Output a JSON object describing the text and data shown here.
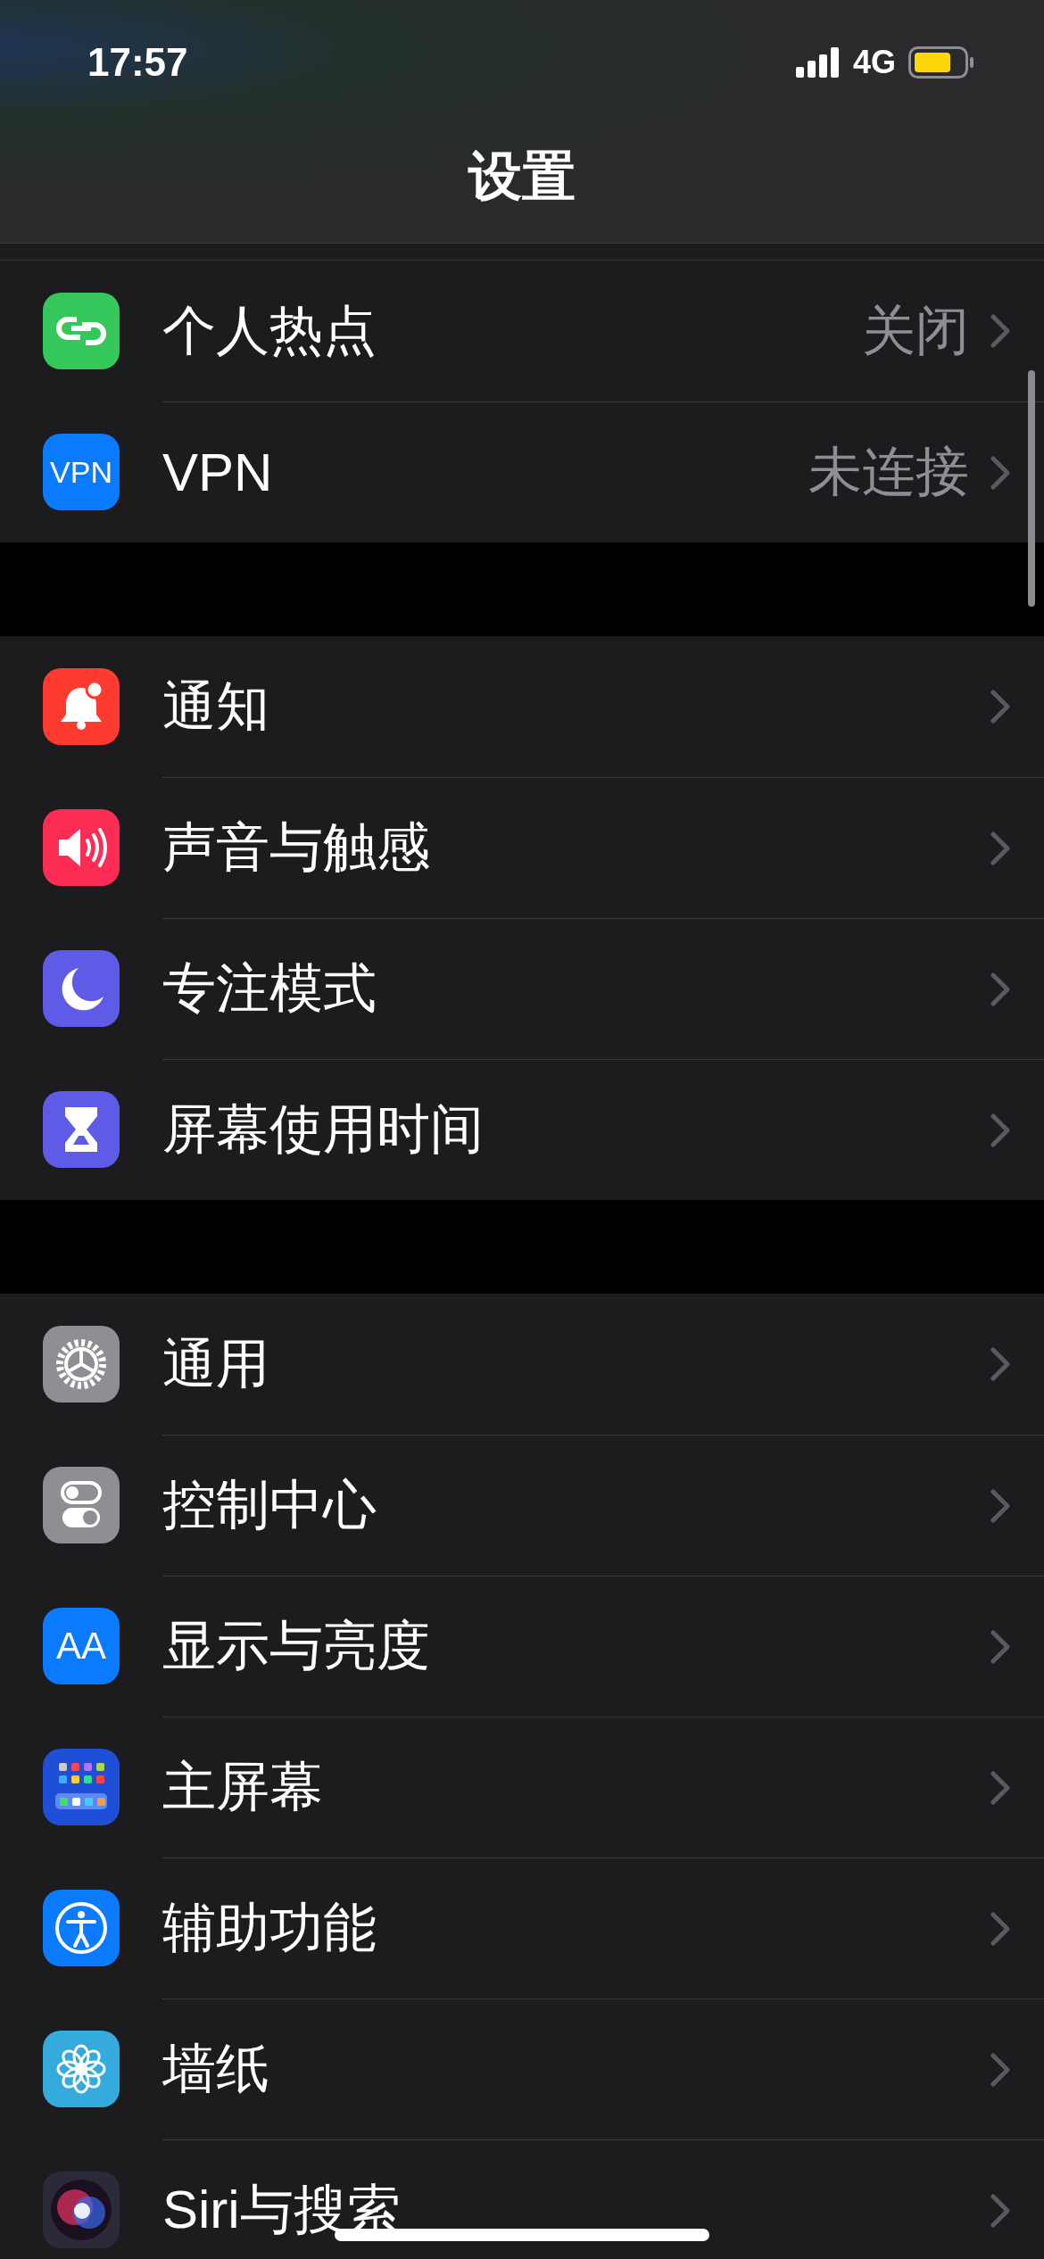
{
  "status_bar": {
    "time": "17:57",
    "network": "4G"
  },
  "title": "设置",
  "groups": [
    {
      "rows": [
        {
          "kind": "hotspot",
          "color": "#34c759",
          "label": "个人热点",
          "value": "关闭"
        },
        {
          "kind": "vpn",
          "color": "#0a7aff",
          "icon_text": "VPN",
          "label": "VPN",
          "value": "未连接"
        }
      ]
    },
    {
      "rows": [
        {
          "kind": "bell",
          "color": "#ff3b30",
          "label": "通知"
        },
        {
          "kind": "speaker",
          "color": "#ff2d55",
          "label": "声音与触感"
        },
        {
          "kind": "moon",
          "color": "#5e5ce6",
          "label": "专注模式"
        },
        {
          "kind": "hourglass",
          "color": "#5e5ce6",
          "label": "屏幕使用时间"
        }
      ]
    },
    {
      "rows": [
        {
          "kind": "gear",
          "color": "#8e8e93",
          "label": "通用"
        },
        {
          "kind": "toggles",
          "color": "#8e8e93",
          "label": "控制中心"
        },
        {
          "kind": "text",
          "color": "#0a7aff",
          "icon_text": "AA",
          "label": "显示与亮度"
        },
        {
          "kind": "grid",
          "color": "#1f4fd8",
          "label": "主屏幕"
        },
        {
          "kind": "accessibility",
          "color": "#0a7aff",
          "label": "辅助功能"
        },
        {
          "kind": "flower",
          "color": "#35aadc",
          "label": "墙纸"
        },
        {
          "kind": "orb",
          "color": "#2a2a3a",
          "label": "Siri与搜索"
        }
      ]
    }
  ]
}
